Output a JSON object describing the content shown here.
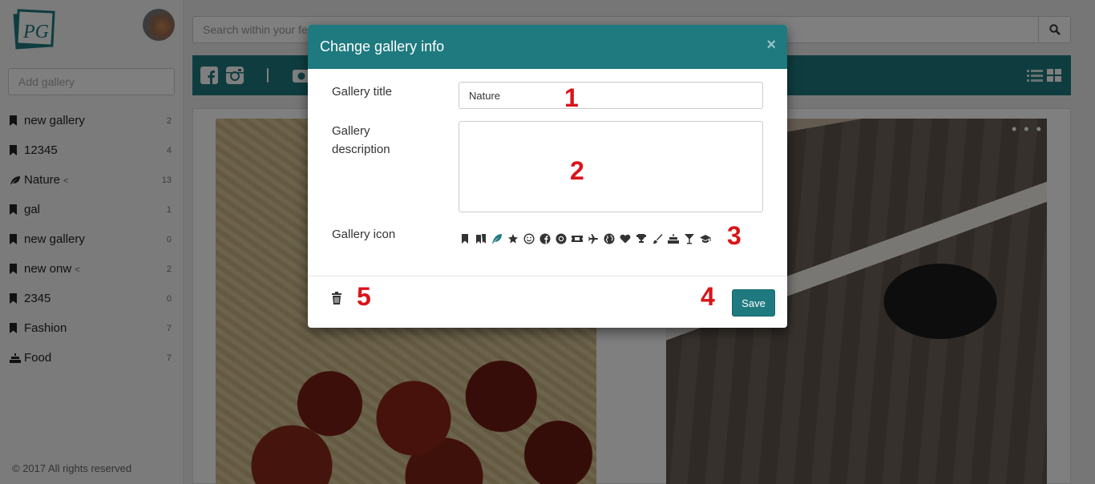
{
  "sidebar": {
    "add_gallery_placeholder": "Add gallery",
    "galleries": [
      {
        "icon": "bookmark-icon",
        "name": "new gallery",
        "count": "2",
        "shared": false
      },
      {
        "icon": "bookmark-icon",
        "name": "12345",
        "count": "4",
        "shared": false
      },
      {
        "icon": "leaf-icon",
        "name": "Nature",
        "count": "13",
        "shared": true
      },
      {
        "icon": "bookmark-icon",
        "name": "gal",
        "count": "1",
        "shared": false
      },
      {
        "icon": "bookmark-icon",
        "name": "new gallery",
        "count": "0",
        "shared": false
      },
      {
        "icon": "bookmark-icon",
        "name": "new onw",
        "count": "2",
        "shared": true
      },
      {
        "icon": "bookmark-icon",
        "name": "2345",
        "count": "0",
        "shared": false
      },
      {
        "icon": "bookmark-icon",
        "name": "Fashion",
        "count": "7",
        "shared": false
      },
      {
        "icon": "cake-icon",
        "name": "Food",
        "count": "7",
        "shared": false
      }
    ],
    "footer": "© 2017 All rights reserved"
  },
  "search": {
    "placeholder": "Search within your feeds"
  },
  "logo_text": "PG",
  "modal": {
    "title": "Change gallery info",
    "close_label": "×",
    "title_label": "Gallery title",
    "title_value": "Nature",
    "description_label_line1": "Gallery",
    "description_label_line2": "description",
    "description_value": "",
    "icon_label": "Gallery icon",
    "icons": [
      "bookmark-icon",
      "bookmarks-icon",
      "leaf-icon",
      "star-icon",
      "smiley-icon",
      "facebook-icon",
      "dribbble-icon",
      "ticket-icon",
      "plane-icon",
      "globe-icon",
      "heart-icon",
      "trophy-icon",
      "brush-icon",
      "cake-icon",
      "cocktail-icon",
      "graduation-cap-icon"
    ],
    "selected_icon": "leaf-icon",
    "save_label": "Save"
  },
  "annotations": [
    "1",
    "2",
    "3",
    "4",
    "5"
  ],
  "colors": {
    "accent": "#1e7a7f",
    "annotation": "#d9141a"
  }
}
